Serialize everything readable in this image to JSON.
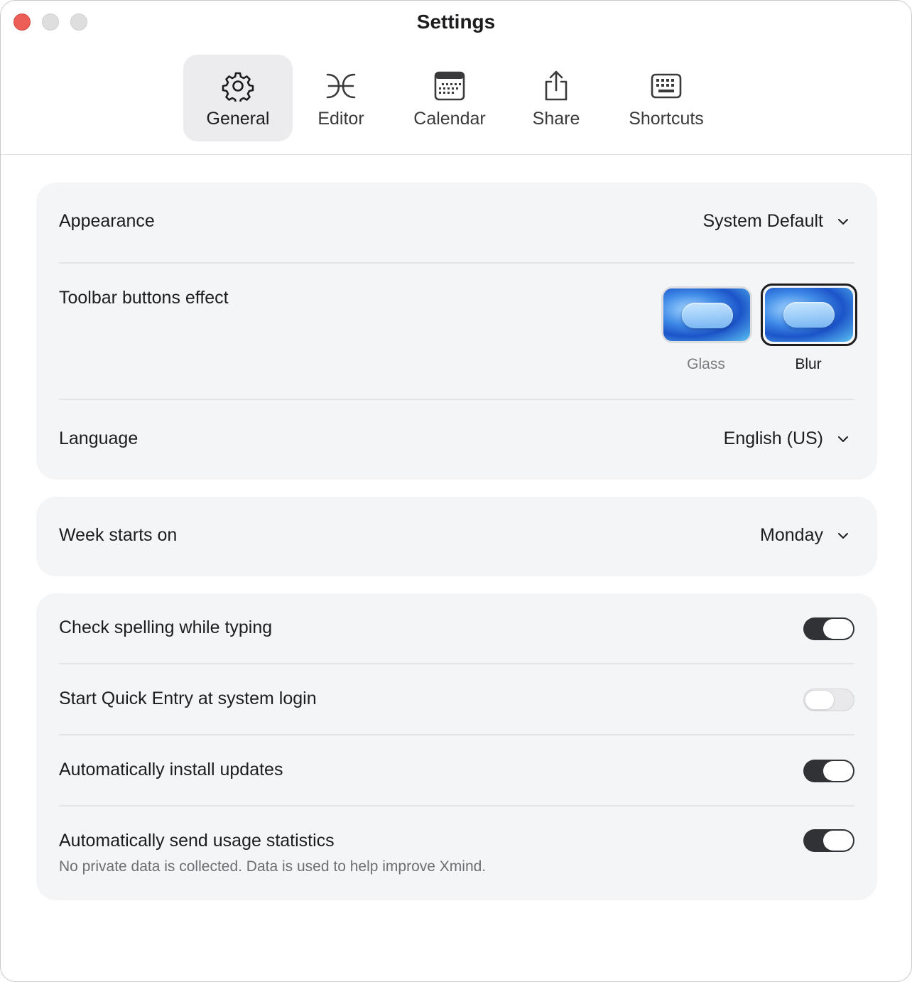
{
  "window": {
    "title": "Settings"
  },
  "tabs": [
    {
      "label": "General",
      "icon": "gear-icon",
      "active": true
    },
    {
      "label": "Editor",
      "icon": "editor-icon",
      "active": false
    },
    {
      "label": "Calendar",
      "icon": "calendar-icon",
      "active": false
    },
    {
      "label": "Share",
      "icon": "share-icon",
      "active": false
    },
    {
      "label": "Shortcuts",
      "icon": "keyboard-icon",
      "active": false
    }
  ],
  "appearance": {
    "label": "Appearance",
    "value": "System Default"
  },
  "toolbar_effect": {
    "label": "Toolbar buttons effect",
    "options": [
      {
        "label": "Glass",
        "selected": false
      },
      {
        "label": "Blur",
        "selected": true
      }
    ]
  },
  "language": {
    "label": "Language",
    "value": "English (US)"
  },
  "week_start": {
    "label": "Week starts on",
    "value": "Monday"
  },
  "toggles": [
    {
      "label": "Check spelling while typing",
      "on": true
    },
    {
      "label": "Start Quick Entry at system login",
      "on": false
    },
    {
      "label": "Automatically install updates",
      "on": true
    },
    {
      "label": "Automatically send usage statistics",
      "on": true,
      "note": "No private data is collected. Data is used to help improve Xmind."
    }
  ],
  "colors": {
    "close": "#ec5f57",
    "toggle_on": "#303235",
    "card_bg": "#f4f5f7"
  }
}
